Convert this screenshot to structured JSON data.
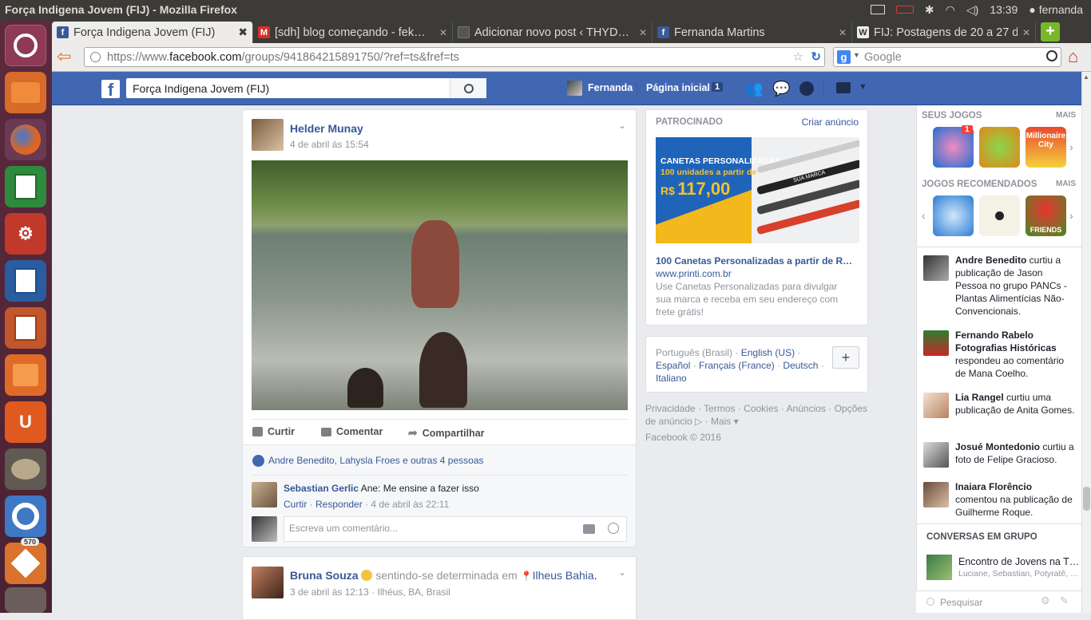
{
  "window": {
    "title": "Força Indigena Jovem (FIJ) - Mozilla Firefox"
  },
  "system": {
    "time": "13:39",
    "user": "fernanda"
  },
  "launcher": {
    "badge": "570"
  },
  "tabs": [
    {
      "label": "Força Indigena Jovem (FIJ)",
      "favicon": "f",
      "color": "#3b5998"
    },
    {
      "label": "[sdh] blog começando - fek…",
      "favicon": "M",
      "color": "#d93025"
    },
    {
      "label": "Adicionar novo post ‹ THYD…",
      "favicon": "",
      "color": "#555555"
    },
    {
      "label": "Fernanda Martins",
      "favicon": "f",
      "color": "#3b5998"
    },
    {
      "label": "FIJ: Postagens de 20 a 27 de…",
      "favicon": "W",
      "color": "#eeeeee"
    }
  ],
  "nav": {
    "url_prefix": "https://www.",
    "url_domain": "facebook.com",
    "url_rest": "/groups/941864215891750/?ref=ts&fref=ts",
    "search_placeholder": "Google"
  },
  "fb": {
    "search_value": "Força Indigena Jovem (FIJ)",
    "user": "Fernanda",
    "home": "Página inicial",
    "home_count": "1"
  },
  "post1": {
    "author": "Helder Munay",
    "time": "4 de abril às 15:54",
    "like": "Curtir",
    "comment": "Comentar",
    "share": "Compartilhar",
    "likes_text": "Andre Benedito, Lahysla Froes e outras 4 pessoas",
    "comment_author": "Sebastian Gerlic",
    "comment_text": "Ane: Me ensine a fazer isso",
    "comment_like": "Curtir",
    "comment_reply": "Responder",
    "comment_time": "4 de abril às 22:11",
    "comment_placeholder": "Escreva um comentário..."
  },
  "post2": {
    "author": "Bruna Souza",
    "feeling": "sentindo-se determinada em",
    "place": "Ilheus Bahia",
    "time": "3 de abril às 12:13 · Ilhéus, BA, Brasil"
  },
  "ad": {
    "header": "PATROCINADO",
    "create": "Criar anúncio",
    "banner_line1": "CANETAS PERSONALIZADAS",
    "banner_line2": "100 unidades a partir de",
    "banner_price_prefix": "R$",
    "banner_price": "117,00",
    "pen_label": "SUA MARCA",
    "title": "100 Canetas Personalizadas a partir de R…",
    "site": "www.printi.com.br",
    "desc": "Use Canetas Personalizadas para divulgar sua marca e receba em seu endereço com frete grátis!"
  },
  "languages": {
    "current": "Português (Brasil)",
    "items": [
      "English (US)",
      "Español",
      "Français (France)",
      "Deutsch",
      "Italiano"
    ]
  },
  "footer": {
    "links": [
      "Privacidade",
      "Termos",
      "Cookies",
      "Anúncios",
      "Opções de anúncio",
      "Mais"
    ],
    "copyright": "Facebook © 2016"
  },
  "sidebar": {
    "my_games": "SEUS JOGOS",
    "more": "MAIS",
    "recommended": "JOGOS RECOMENDADOS",
    "game_badge": "1",
    "game_city": "Millionaire City",
    "game_friends": "FRIENDS",
    "activity": [
      {
        "name": "Andre Benedito",
        "text": " curtiu a publicação de Jason Pessoa no grupo PANCs - Plantas Alimentícias Não-Convencionais."
      },
      {
        "name": "Fernando Rabelo Fotografias Históricas",
        "text": " respondeu ao comentário de Mana Coelho."
      },
      {
        "name": "Lia Rangel",
        "text": " curtiu uma publicação de Anita Gomes."
      },
      {
        "name": "Josué Montedonio",
        "text": " curtiu a foto de Felipe Gracioso."
      },
      {
        "name": "Inaiara Florêncio",
        "text": " comentou na publicação de Guilherme Roque."
      }
    ],
    "group_chats": "CONVERSAS EM GRUPO",
    "chat_title": "Encontro de Jovens na T…",
    "chat_members": "Luciane, Sebastian, Potyratê, …",
    "chat_search": "Pesquisar"
  }
}
